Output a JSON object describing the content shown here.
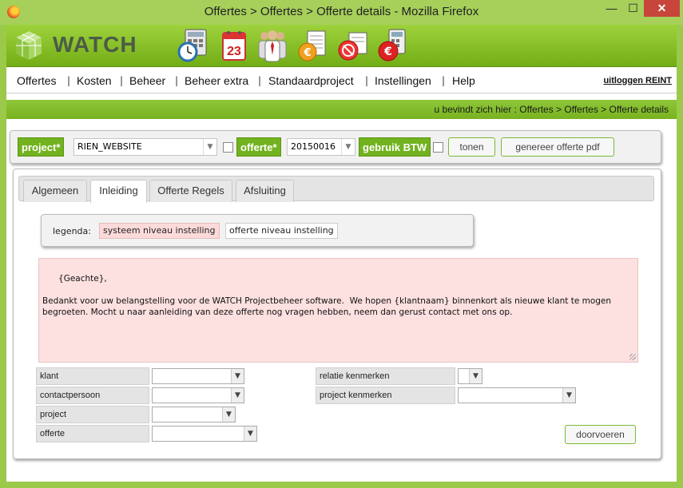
{
  "window": {
    "title": "Offertes > Offertes > Offerte details - Mozilla Firefox",
    "minimize": "—",
    "maximize": "☐",
    "close": "✕"
  },
  "header": {
    "logo_text": "WATCH",
    "icons": [
      "clock-calculator-icon",
      "calendar-23-icon",
      "people-icon",
      "euro-invoice-icon",
      "euro-no-icon",
      "euro-calculator-icon"
    ],
    "calendar_day": "23"
  },
  "menu": {
    "items": [
      "Offertes",
      "Kosten",
      "Beheer",
      "Beheer extra",
      "Standaardproject",
      "Instellingen",
      "Help"
    ],
    "separator": "|",
    "logout": "uitloggen REINT"
  },
  "breadcrumb": "u bevindt zich hier : Offertes > Offertes > Offerte details",
  "toolbar": {
    "project_label": "project*",
    "project_value": "RIEN_WEBSITE",
    "offerte_label": "offerte*",
    "offerte_value": "20150016",
    "btw_label": "gebruik BTW",
    "tonen": "tonen",
    "genereer": "genereer offerte pdf"
  },
  "tabs": [
    "Algemeen",
    "Inleiding",
    "Offerte Regels",
    "Afsluiting"
  ],
  "active_tab": "Inleiding",
  "legend": {
    "label": "legenda:",
    "system": "systeem niveau instelling",
    "offerte": "offerte niveau instelling"
  },
  "intro_text": "{Geachte},\n\nBedankt voor uw belangstelling voor de WATCH Projectbeheer software.  We hopen {klantnaam} binnenkort als nieuwe klant te mogen begroeten. Mocht u naar aanleiding van deze offerte nog vragen hebben, neem dan gerust contact met ons op.",
  "fields": {
    "klant": "klant",
    "contactpersoon": "contactpersoon",
    "project": "project",
    "offerte": "offerte",
    "relatie": "relatie kenmerken",
    "project_kenmerken": "project kenmerken"
  },
  "doorvoeren": "doorvoeren",
  "colors": {
    "green_accent": "#72b21f",
    "system_bg": "#fddada"
  }
}
